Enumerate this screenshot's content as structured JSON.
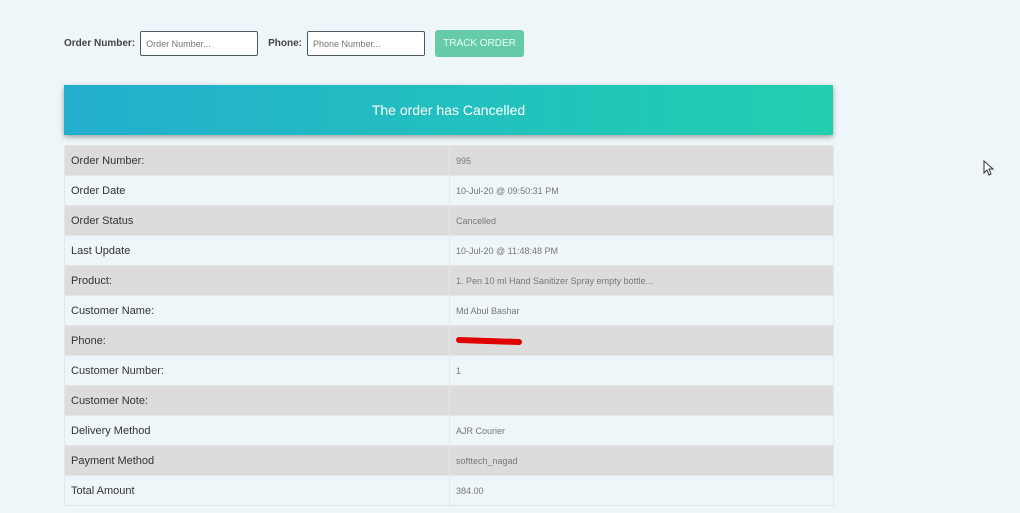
{
  "form": {
    "order_label": "Order Number:",
    "order_placeholder": "Order Number...",
    "phone_label": "Phone:",
    "phone_placeholder": "Phone Number...",
    "button": "TRACK ORDER"
  },
  "banner": "The order has Cancelled",
  "rows": [
    {
      "k": "Order Number:",
      "v": "995"
    },
    {
      "k": "Order Date",
      "v": "10-Jul-20 @ 09:50:31 PM"
    },
    {
      "k": "Order Status",
      "v": "Cancelled"
    },
    {
      "k": "Last Update",
      "v": "10-Jul-20 @ 11:48:48 PM"
    },
    {
      "k": "Product:",
      "v": "1. Pen 10 ml Hand Sanitizer Spray empty bottle..."
    },
    {
      "k": "Customer Name:",
      "v": "Md Abul Bashar"
    },
    {
      "k": "Phone:"
    },
    {
      "k": "Customer Number:",
      "v": "1"
    },
    {
      "k": "Customer Note:",
      "v": ""
    },
    {
      "k": "Delivery Method",
      "v": "AJR Courier"
    },
    {
      "k": "Payment Method",
      "v": "softtech_nagad"
    },
    {
      "k": "Total Amount",
      "v": "384.00"
    }
  ]
}
